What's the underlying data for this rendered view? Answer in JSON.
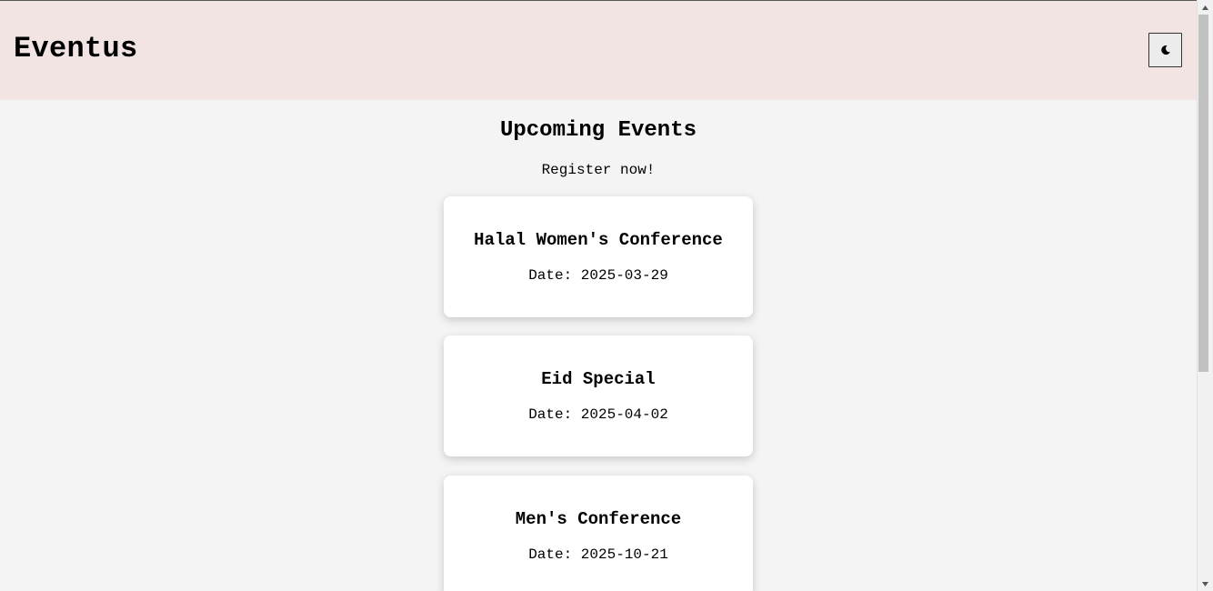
{
  "header": {
    "brand": "Eventus",
    "theme_toggle_icon": "moon-icon"
  },
  "main": {
    "title": "Upcoming Events",
    "subtitle": "Register now!"
  },
  "events": [
    {
      "title": "Halal Women's Conference",
      "date": "Date: 2025-03-29"
    },
    {
      "title": "Eid Special",
      "date": "Date: 2025-04-02"
    },
    {
      "title": "Men's Conference",
      "date": "Date: 2025-10-21"
    }
  ],
  "colors": {
    "header_bg": "#f3e4e4",
    "page_bg": "#f4f4f4",
    "card_bg": "#ffffff"
  }
}
